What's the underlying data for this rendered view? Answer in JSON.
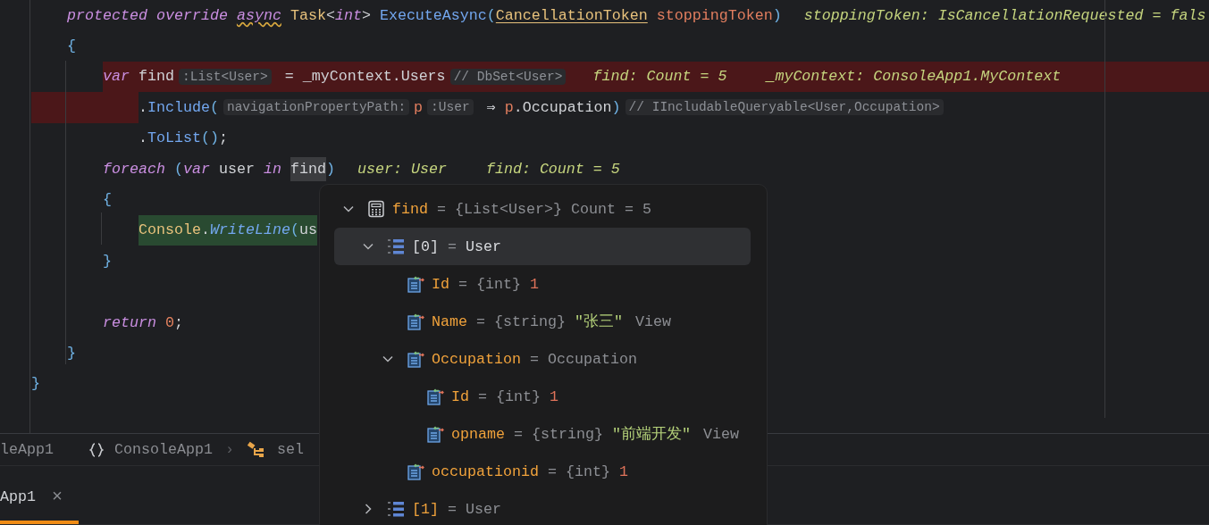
{
  "editor": {
    "lines": [
      {
        "kind": "block",
        "children": [
          {
            "kind": "code",
            "segments": [
              {
                "kind": "code",
                "tokens": [
                  {
                    "t": "protected override ",
                    "kind": "kw"
                  },
                  {
                    "t": "async",
                    "kind": "kw-warn"
                  },
                  {
                    "t": " Task",
                    "kind": "type"
                  },
                  {
                    "t": "<",
                    "kind": "plain"
                  },
                  {
                    "t": "int",
                    "kind": "kw"
                  },
                  {
                    "t": "> ",
                    "kind": "plain"
                  },
                  {
                    "t": "ExecuteAsync",
                    "kind": "method"
                  },
                  {
                    "t": "(",
                    "kind": "punct"
                  },
                  {
                    "t": "CancellationToken",
                    "kind": "type-link"
                  },
                  {
                    "t": " stoppingToken",
                    "kind": "param"
                  },
                  {
                    "t": ")",
                    "kind": "punct"
                  }
                ]
              },
              {
                "kind": "value",
                "text": "stoppingToken: IsCancellationRequested = fals"
              }
            ]
          },
          {
            "kind": "code",
            "segments": [
              {
                "kind": "code",
                "tokens": [
                  {
                    "t": "{",
                    "kind": "punct"
                  }
                ]
              }
            ],
            "children": [
              {
                "kind": "breakpoint",
                "segments": [
                  {
                    "kind": "code",
                    "tokens": [
                      {
                        "t": "var",
                        "kind": "kw"
                      },
                      {
                        "t": " find",
                        "kind": "plain"
                      }
                    ]
                  },
                  {
                    "kind": "hint",
                    "text": ":List<User>"
                  },
                  {
                    "kind": "code",
                    "tokens": [
                      {
                        "t": " = _myContext.Users",
                        "kind": "plain"
                      }
                    ]
                  },
                  {
                    "kind": "hint",
                    "text": "// DbSet<User>"
                  },
                  {
                    "kind": "value",
                    "text": "find: Count = 5"
                  },
                  {
                    "kind": "value",
                    "text": "_myContext: ConsoleApp1.MyContext"
                  }
                ],
                "children": [
                  {
                    "kind": "breakpoint-start",
                    "segments": [
                      {
                        "kind": "code",
                        "tokens": [
                          {
                            "t": ".",
                            "kind": "plain"
                          },
                          {
                            "t": "Include",
                            "kind": "method"
                          },
                          {
                            "t": "(",
                            "kind": "punct"
                          }
                        ]
                      },
                      {
                        "kind": "hint",
                        "text": "navigationPropertyPath:"
                      },
                      {
                        "kind": "code",
                        "tokens": [
                          {
                            "t": "p",
                            "kind": "param"
                          }
                        ]
                      },
                      {
                        "kind": "hint",
                        "text": ":User"
                      },
                      {
                        "kind": "code",
                        "tokens": [
                          {
                            "t": " ⇒ ",
                            "kind": "plain"
                          },
                          {
                            "t": "p",
                            "kind": "param"
                          },
                          {
                            "t": ".Occupation",
                            "kind": "plain"
                          },
                          {
                            "t": ")",
                            "kind": "punct"
                          }
                        ]
                      },
                      {
                        "kind": "hint",
                        "text": "// IIncludableQueryable<User,Occupation>"
                      }
                    ]
                  },
                  {
                    "kind": "code",
                    "segments": [
                      {
                        "kind": "code",
                        "tokens": [
                          {
                            "t": ".",
                            "kind": "plain"
                          },
                          {
                            "t": "ToList",
                            "kind": "method"
                          },
                          {
                            "t": "()",
                            "kind": "punct"
                          },
                          {
                            "t": ";",
                            "kind": "plain"
                          }
                        ]
                      }
                    ]
                  }
                ]
              },
              {
                "kind": "code",
                "segments": [
                  {
                    "kind": "code",
                    "tokens": [
                      {
                        "t": "foreach",
                        "kind": "kw"
                      },
                      {
                        "t": " (",
                        "kind": "punct"
                      },
                      {
                        "t": "var",
                        "kind": "kw"
                      },
                      {
                        "t": " user ",
                        "kind": "plain"
                      },
                      {
                        "t": "in ",
                        "kind": "kw"
                      },
                      {
                        "t": "find",
                        "kind": "selected"
                      },
                      {
                        "t": ")",
                        "kind": "punct"
                      }
                    ]
                  },
                  {
                    "kind": "value",
                    "text": "user: User"
                  },
                  {
                    "kind": "value",
                    "text": "find: Count = 5"
                  }
                ]
              },
              {
                "kind": "code",
                "segments": [
                  {
                    "kind": "code",
                    "tokens": [
                      {
                        "t": "{",
                        "kind": "punct"
                      }
                    ]
                  }
                ],
                "children": [
                  {
                    "kind": "execution",
                    "segments": [
                      {
                        "kind": "code",
                        "tokens": [
                          {
                            "t": "Console",
                            "kind": "type"
                          },
                          {
                            "t": ".",
                            "kind": "plain"
                          },
                          {
                            "t": "WriteLine",
                            "kind": "method-italic"
                          },
                          {
                            "t": "(",
                            "kind": "punct"
                          },
                          {
                            "t": "us",
                            "kind": "plain"
                          }
                        ]
                      }
                    ]
                  }
                ]
              },
              {
                "kind": "code",
                "segments": [
                  {
                    "kind": "code",
                    "tokens": [
                      {
                        "t": "}",
                        "kind": "punct"
                      }
                    ]
                  }
                ]
              },
              {
                "kind": "blank"
              },
              {
                "kind": "code",
                "segments": [
                  {
                    "kind": "code",
                    "tokens": [
                      {
                        "t": "return ",
                        "kind": "kw"
                      },
                      {
                        "t": "0",
                        "kind": "number"
                      },
                      {
                        "t": ";",
                        "kind": "plain"
                      }
                    ]
                  }
                ]
              }
            ]
          },
          {
            "kind": "code",
            "segments": [
              {
                "kind": "code",
                "tokens": [
                  {
                    "t": "}",
                    "kind": "punct"
                  }
                ]
              }
            ]
          }
        ]
      },
      {
        "kind": "code",
        "segments": [
          {
            "kind": "code",
            "tokens": [
              {
                "t": "}",
                "kind": "punct"
              }
            ]
          }
        ]
      }
    ]
  },
  "popup": {
    "items": [
      {
        "kind": "collection",
        "name": "find",
        "expanded": true,
        "selected": false,
        "equals": "=",
        "type": "{List<User>}",
        "value": {
          "text": "Count = 5",
          "kind": "plain"
        },
        "children": [
          {
            "kind": "element",
            "name": "[0]",
            "expanded": true,
            "selected": true,
            "equals": "=",
            "value": {
              "text": "User",
              "kind": "plain"
            },
            "children": [
              {
                "kind": "field",
                "name": "Id",
                "selected": false,
                "equals": "=",
                "type": "{int}",
                "value": {
                  "text": "1",
                  "kind": "number"
                }
              },
              {
                "kind": "field",
                "name": "Name",
                "selected": false,
                "equals": "=",
                "type": "{string}",
                "value": {
                  "text": "\"张三\"",
                  "kind": "string"
                },
                "link": "View"
              },
              {
                "kind": "field",
                "name": "Occupation",
                "expanded": true,
                "selected": false,
                "equals": "=",
                "value": {
                  "text": "Occupation",
                  "kind": "plain"
                },
                "children": [
                  {
                    "kind": "field",
                    "name": "Id",
                    "selected": false,
                    "equals": "=",
                    "type": "{int}",
                    "value": {
                      "text": "1",
                      "kind": "number"
                    }
                  },
                  {
                    "kind": "field",
                    "name": "opname",
                    "selected": false,
                    "equals": "=",
                    "type": "{string}",
                    "value": {
                      "text": "\"前端开发\"",
                      "kind": "string"
                    },
                    "link": "View"
                  }
                ]
              },
              {
                "kind": "field",
                "name": "occupationid",
                "selected": false,
                "equals": "=",
                "type": "{int}",
                "value": {
                  "text": "1",
                  "kind": "number"
                }
              }
            ]
          },
          {
            "kind": "element",
            "name": "[1]",
            "expanded": false,
            "selected": false,
            "equals": "=",
            "value": {
              "text": "User",
              "kind": "plain"
            }
          }
        ]
      }
    ]
  },
  "breadcrumbs": [
    {
      "kind": "project",
      "text": "leApp1"
    },
    {
      "kind": "namespace",
      "text": "ConsoleApp1"
    },
    {
      "kind": "separator",
      "text": "›"
    },
    {
      "kind": "method",
      "text": "sel"
    }
  ],
  "tabs": [
    {
      "label": "App1",
      "selected": true,
      "close": "×"
    }
  ]
}
